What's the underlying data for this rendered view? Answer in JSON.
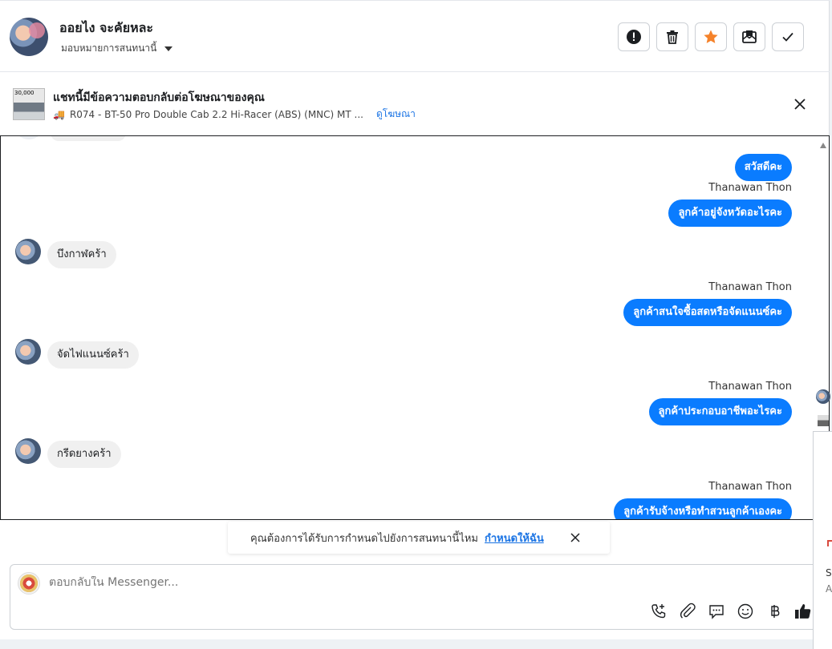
{
  "header": {
    "contact_name": "ออยไง จะคัยหละ",
    "assign_label": "มอบหมายการสนทนานี้",
    "actions": [
      {
        "name": "alert-icon"
      },
      {
        "name": "trash-icon"
      },
      {
        "name": "star-icon"
      },
      {
        "name": "mark-unread-icon"
      },
      {
        "name": "check-icon"
      }
    ]
  },
  "ad": {
    "title": "แชทนี้มีข้อความตอบกลับต่อโฆษณาของคุณ",
    "thumb_text": "30,000",
    "product_emoji": "🚚",
    "product": "R074 - BT-50 Pro Double Cab 2.2 Hi-Racer (ABS) (MNC) MT ...",
    "view_ad_label": "ดูโฆษณา"
  },
  "messages": [
    {
      "dir": "out",
      "text": "สวัสดีคะ"
    },
    {
      "dir": "out",
      "sender": "Thanawan Thon",
      "text": "ลูกค้าอยู่จังหวัดอะไรคะ"
    },
    {
      "dir": "in",
      "text": "บึงกาฬคร้า"
    },
    {
      "dir": "out",
      "sender": "Thanawan Thon",
      "text": "ลูกค้าสนใจซื้อสดหรือจัดแนนซ์คะ"
    },
    {
      "dir": "in",
      "text": "จัดไฟแนนซ์คร้า"
    },
    {
      "dir": "out",
      "sender": "Thanawan Thon",
      "text": "ลูกค้าประกอบอาชีพอะไรคะ"
    },
    {
      "dir": "in",
      "text": "กรีดยางคร้า"
    },
    {
      "dir": "out",
      "sender": "Thanawan Thon",
      "text": "ลูกค้ารับจ้างหรือทำสวนลูกค้าเองคะ"
    }
  ],
  "suggestion": {
    "text": "คุณต้องการได้รับการกำหนดไปยังการสนทนานี้ไหม",
    "link": "กำหนดให้ฉัน"
  },
  "composer": {
    "placeholder": "ตอบกลับใน Messenger...",
    "tools": [
      "phone-plus-icon",
      "paperclip-icon",
      "quick-reply-icon",
      "emoji-icon",
      "baht-icon",
      "thumbs-up-icon"
    ]
  },
  "side_panel": {
    "letter_s": "S",
    "letter_a": "A"
  },
  "colors": {
    "accent": "#0a7cff",
    "link": "#1b74e4",
    "star": "#f5822a"
  }
}
